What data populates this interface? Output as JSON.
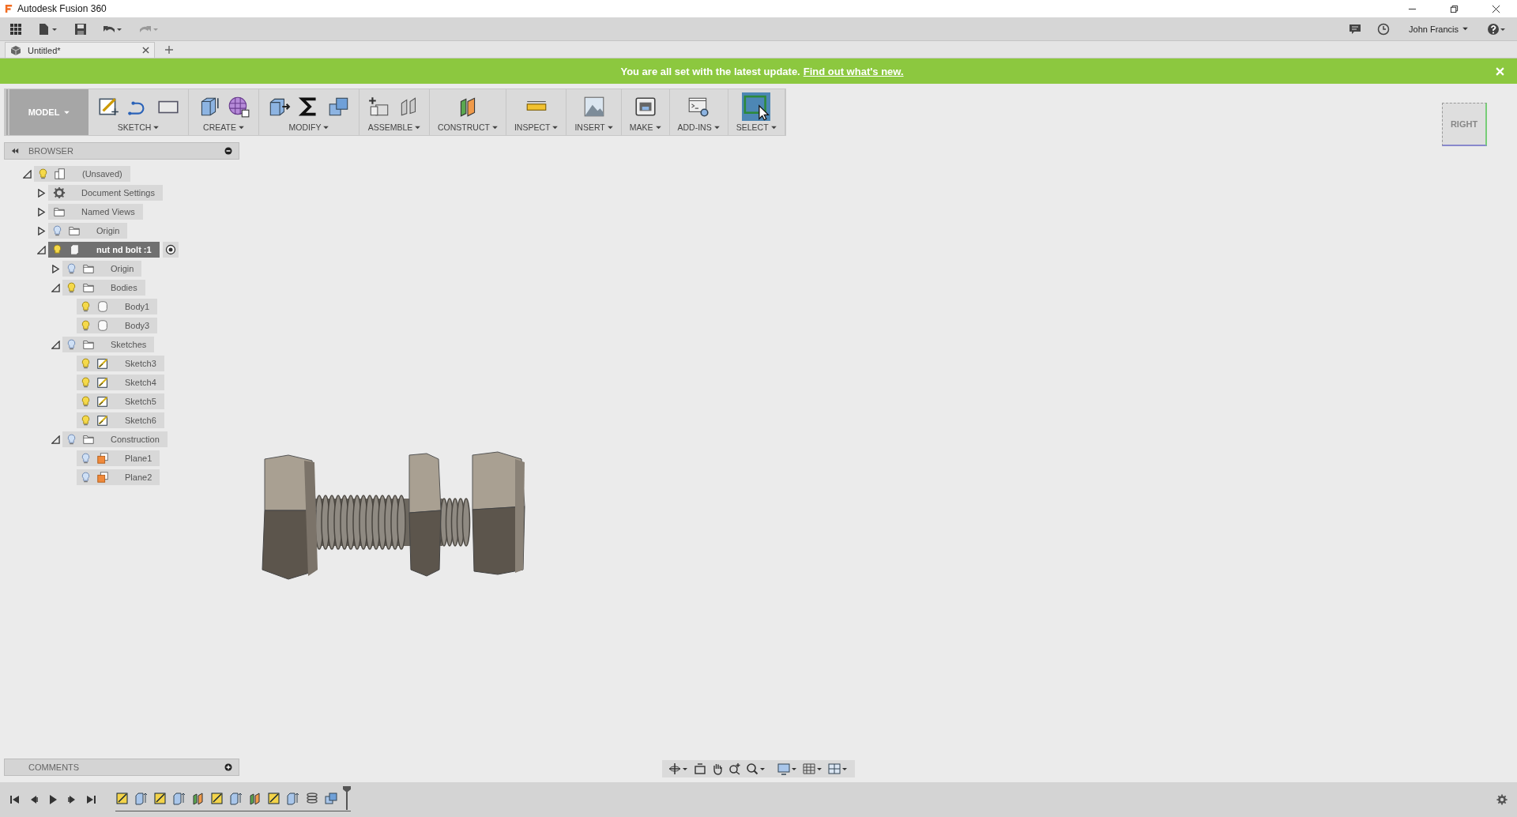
{
  "window": {
    "title": "Autodesk Fusion 360"
  },
  "app_bar": {
    "user": "John Francis"
  },
  "tabs": [
    {
      "label": "Untitled*",
      "selected": true
    }
  ],
  "banner": {
    "message": "You are all set with the latest update.",
    "link": "Find out what's new."
  },
  "toolbar": {
    "workspace": "MODEL",
    "groups": [
      {
        "label": "SKETCH",
        "selected": false
      },
      {
        "label": "CREATE",
        "selected": false
      },
      {
        "label": "MODIFY",
        "selected": false
      },
      {
        "label": "ASSEMBLE",
        "selected": false
      },
      {
        "label": "CONSTRUCT",
        "selected": false
      },
      {
        "label": "INSPECT",
        "selected": false
      },
      {
        "label": "INSERT",
        "selected": false
      },
      {
        "label": "MAKE",
        "selected": false
      },
      {
        "label": "ADD-INS",
        "selected": false
      },
      {
        "label": "SELECT",
        "selected": true
      }
    ]
  },
  "browser": {
    "title": "BROWSER",
    "tree": [
      {
        "label": "(Unsaved)",
        "kind": "document",
        "visible": true,
        "expanded": true,
        "selected": false,
        "children": [
          {
            "label": "Document Settings",
            "kind": "settings",
            "expanded": false,
            "selected": false
          },
          {
            "label": "Named Views",
            "kind": "folder",
            "expanded": false,
            "selected": false
          },
          {
            "label": "Origin",
            "kind": "folder",
            "visible": false,
            "expanded": false,
            "selected": false
          },
          {
            "label": "nut nd bolt :1",
            "kind": "component",
            "visible": true,
            "expanded": true,
            "selected": true,
            "children": [
              {
                "label": "Origin",
                "kind": "folder",
                "visible": false,
                "expanded": false,
                "selected": false
              },
              {
                "label": "Bodies",
                "kind": "folder",
                "visible": true,
                "expanded": true,
                "selected": false,
                "children": [
                  {
                    "label": "Body1",
                    "kind": "body",
                    "visible": true,
                    "selected": false
                  },
                  {
                    "label": "Body3",
                    "kind": "body",
                    "visible": true,
                    "selected": false
                  }
                ]
              },
              {
                "label": "Sketches",
                "kind": "folder",
                "visible": false,
                "expanded": true,
                "selected": false,
                "children": [
                  {
                    "label": "Sketch3",
                    "kind": "sketch",
                    "visible": true,
                    "selected": false
                  },
                  {
                    "label": "Sketch4",
                    "kind": "sketch",
                    "visible": true,
                    "selected": false
                  },
                  {
                    "label": "Sketch5",
                    "kind": "sketch",
                    "visible": true,
                    "selected": false
                  },
                  {
                    "label": "Sketch6",
                    "kind": "sketch",
                    "visible": true,
                    "selected": false
                  }
                ]
              },
              {
                "label": "Construction",
                "kind": "folder",
                "visible": false,
                "expanded": true,
                "selected": false,
                "children": [
                  {
                    "label": "Plane1",
                    "kind": "plane",
                    "visible": false,
                    "selected": false
                  },
                  {
                    "label": "Plane2",
                    "kind": "plane",
                    "visible": false,
                    "selected": false
                  }
                ]
              }
            ]
          }
        ]
      }
    ]
  },
  "viewcube": {
    "face": "RIGHT"
  },
  "comments": {
    "title": "COMMENTS"
  }
}
